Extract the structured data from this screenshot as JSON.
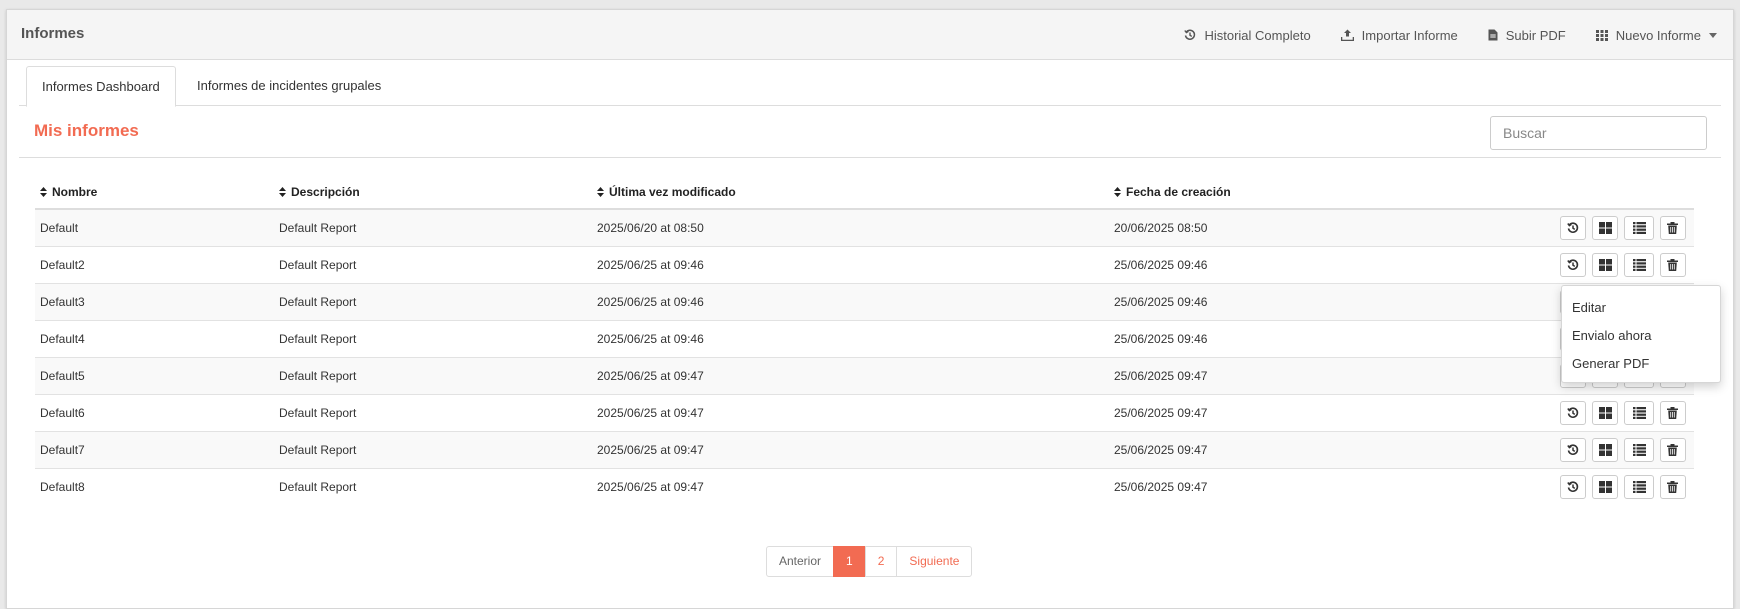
{
  "header": {
    "title": "Informes",
    "actions": {
      "history": "Historial Completo",
      "import": "Importar Informe",
      "upload_pdf": "Subir PDF",
      "new_report": "Nuevo Informe"
    }
  },
  "tabs": [
    {
      "label": "Informes Dashboard",
      "active": true
    },
    {
      "label": "Informes de incidentes grupales",
      "active": false
    }
  ],
  "section": {
    "title": "Mis informes",
    "search_placeholder": "Buscar"
  },
  "table": {
    "columns": [
      "Nombre",
      "Descripción",
      "Última vez modificado",
      "Fecha de creación"
    ],
    "rows": [
      {
        "name": "Default",
        "description": "Default Report",
        "modified": "2025/06/20 at 08:50",
        "created": "20/06/2025 08:50"
      },
      {
        "name": "Default2",
        "description": "Default Report",
        "modified": "2025/06/25 at 09:46",
        "created": "25/06/2025 09:46"
      },
      {
        "name": "Default3",
        "description": "Default Report",
        "modified": "2025/06/25 at 09:46",
        "created": "25/06/2025 09:46"
      },
      {
        "name": "Default4",
        "description": "Default Report",
        "modified": "2025/06/25 at 09:46",
        "created": "25/06/2025 09:46"
      },
      {
        "name": "Default5",
        "description": "Default Report",
        "modified": "2025/06/25 at 09:47",
        "created": "25/06/2025 09:47"
      },
      {
        "name": "Default6",
        "description": "Default Report",
        "modified": "2025/06/25 at 09:47",
        "created": "25/06/2025 09:47"
      },
      {
        "name": "Default7",
        "description": "Default Report",
        "modified": "2025/06/25 at 09:47",
        "created": "25/06/2025 09:47"
      },
      {
        "name": "Default8",
        "description": "Default Report",
        "modified": "2025/06/25 at 09:47",
        "created": "25/06/2025 09:47"
      }
    ],
    "row_action_icons": [
      "history-icon",
      "dashboard-icon",
      "list-icon",
      "trash-icon"
    ]
  },
  "dropdown_menu": {
    "items": [
      "Editar",
      "Envialo ahora",
      "Generar PDF"
    ]
  },
  "pagination": {
    "prev": "Anterior",
    "pages": [
      "1",
      "2"
    ],
    "current": "1",
    "next": "Siguiente"
  },
  "colors": {
    "accent": "#f26b52",
    "header_bg": "#f5f5f5"
  }
}
